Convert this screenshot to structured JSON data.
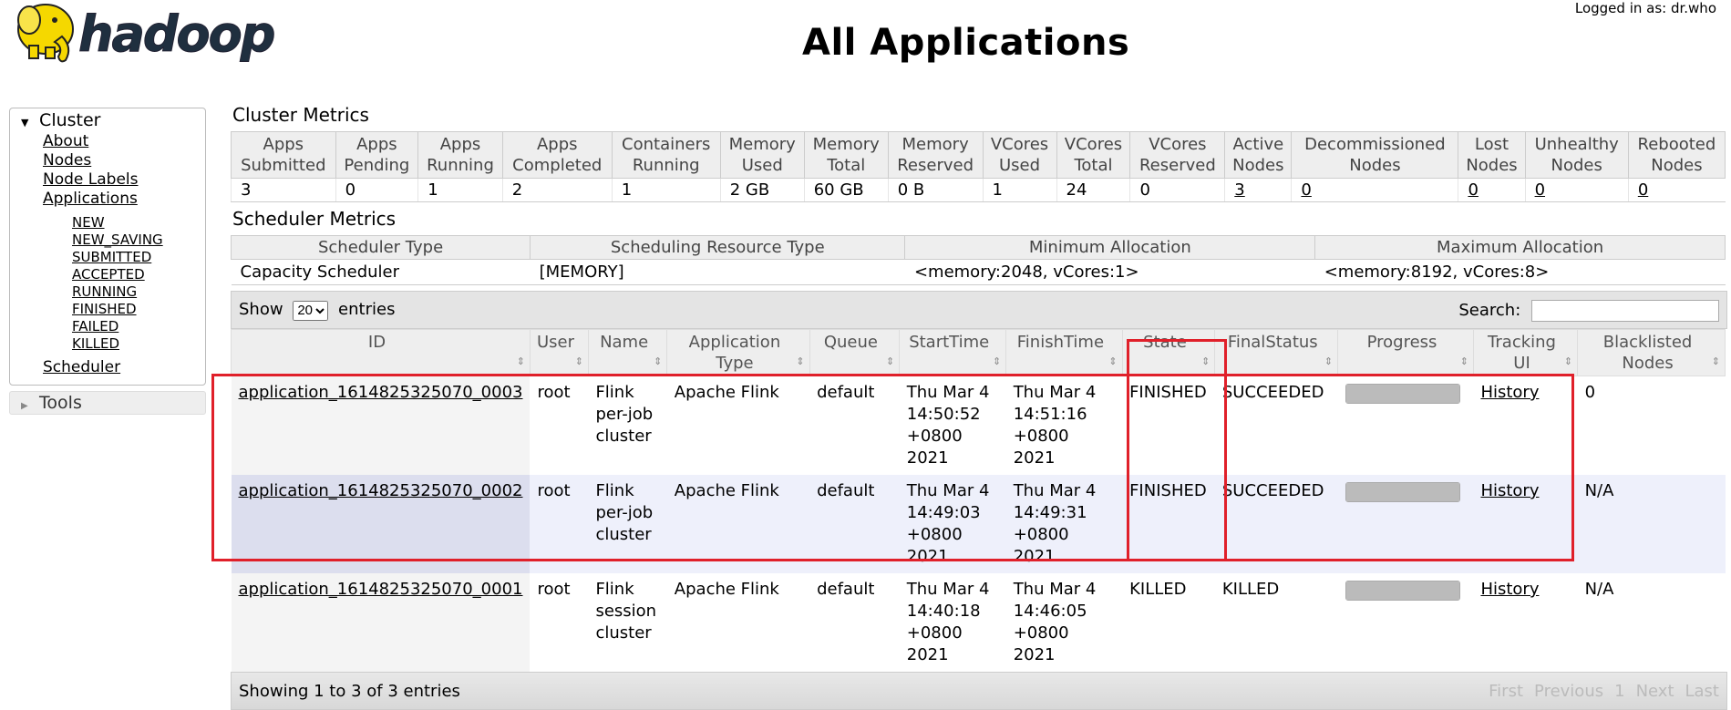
{
  "header": {
    "logo_text": "hadoop",
    "title": "All Applications",
    "logged_in": "Logged in as: dr.who"
  },
  "nav": {
    "cluster_label": "Cluster",
    "items": [
      {
        "label": "About"
      },
      {
        "label": "Nodes"
      },
      {
        "label": "Node Labels"
      },
      {
        "label": "Applications"
      }
    ],
    "app_states": [
      "NEW",
      "NEW_SAVING",
      "SUBMITTED",
      "ACCEPTED",
      "RUNNING",
      "FINISHED",
      "FAILED",
      "KILLED"
    ],
    "scheduler_label": "Scheduler",
    "tools_label": "Tools"
  },
  "cluster_metrics": {
    "title": "Cluster Metrics",
    "headers": [
      [
        "Apps",
        "Submitted"
      ],
      [
        "Apps",
        "Pending"
      ],
      [
        "Apps",
        "Running"
      ],
      [
        "Apps",
        "Completed"
      ],
      [
        "Containers",
        "Running"
      ],
      [
        "Memory",
        "Used"
      ],
      [
        "Memory",
        "Total"
      ],
      [
        "Memory",
        "Reserved"
      ],
      [
        "VCores",
        "Used"
      ],
      [
        "VCores",
        "Total"
      ],
      [
        "VCores",
        "Reserved"
      ],
      [
        "Active",
        "Nodes"
      ],
      [
        "Decommissioned",
        "Nodes"
      ],
      [
        "Lost",
        "Nodes"
      ],
      [
        "Unhealthy",
        "Nodes"
      ],
      [
        "Rebooted",
        "Nodes"
      ]
    ],
    "values": [
      "3",
      "0",
      "1",
      "2",
      "1",
      "2 GB",
      "60 GB",
      "0 B",
      "1",
      "24",
      "0",
      "3",
      "0",
      "0",
      "0",
      "0"
    ],
    "link_columns": [
      11,
      12,
      13,
      14,
      15
    ]
  },
  "scheduler_metrics": {
    "title": "Scheduler Metrics",
    "headers": [
      "Scheduler Type",
      "Scheduling Resource Type",
      "Minimum Allocation",
      "Maximum Allocation"
    ],
    "values": [
      "Capacity Scheduler",
      "[MEMORY]",
      "<memory:2048, vCores:1>",
      "<memory:8192, vCores:8>"
    ]
  },
  "apps_table": {
    "show_label": "Show",
    "entries_label": "entries",
    "page_size": "20",
    "search_label": "Search:",
    "search_value": "",
    "columns": [
      [
        "ID"
      ],
      [
        "User"
      ],
      [
        "Name"
      ],
      [
        "Application",
        "Type"
      ],
      [
        "Queue"
      ],
      [
        "StartTime"
      ],
      [
        "FinishTime"
      ],
      [
        "State"
      ],
      [
        "FinalStatus"
      ],
      [
        "Progress"
      ],
      [
        "Tracking UI"
      ],
      [
        "Blacklisted",
        "Nodes"
      ]
    ],
    "rows": [
      {
        "id": "application_1614825325070_0003",
        "user": "root",
        "name": [
          "Flink",
          "per-job",
          "cluster"
        ],
        "type": "Apache Flink",
        "queue": "default",
        "start": [
          "Thu Mar 4",
          "14:50:52",
          "+0800",
          "2021"
        ],
        "finish": [
          "Thu Mar 4",
          "14:51:16",
          "+0800 2021"
        ],
        "state": "FINISHED",
        "final_status": "SUCCEEDED",
        "progress": 1.0,
        "tracking": "History",
        "blacklisted": "0"
      },
      {
        "id": "application_1614825325070_0002",
        "user": "root",
        "name": [
          "Flink",
          "per-job",
          "cluster"
        ],
        "type": "Apache Flink",
        "queue": "default",
        "start": [
          "Thu Mar 4",
          "14:49:03",
          "+0800",
          "2021"
        ],
        "finish": [
          "Thu Mar 4",
          "14:49:31",
          "+0800 2021"
        ],
        "state": "FINISHED",
        "final_status": "SUCCEEDED",
        "progress": 1.0,
        "tracking": "History",
        "blacklisted": "N/A"
      },
      {
        "id": "application_1614825325070_0001",
        "user": "root",
        "name": [
          "Flink",
          "session",
          "cluster"
        ],
        "type": "Apache Flink",
        "queue": "default",
        "start": [
          "Thu Mar 4",
          "14:40:18",
          "+0800",
          "2021"
        ],
        "finish": [
          "Thu Mar 4",
          "14:46:05",
          "+0800 2021"
        ],
        "state": "KILLED",
        "final_status": "KILLED",
        "progress": 1.0,
        "tracking": "History",
        "blacklisted": "N/A"
      }
    ],
    "info": "Showing 1 to 3 of 3 entries",
    "pager": [
      "First",
      "Previous",
      "1",
      "Next",
      "Last"
    ]
  },
  "colors": {
    "highlight": "#e0202a",
    "row_alt": "#eef0fb"
  }
}
